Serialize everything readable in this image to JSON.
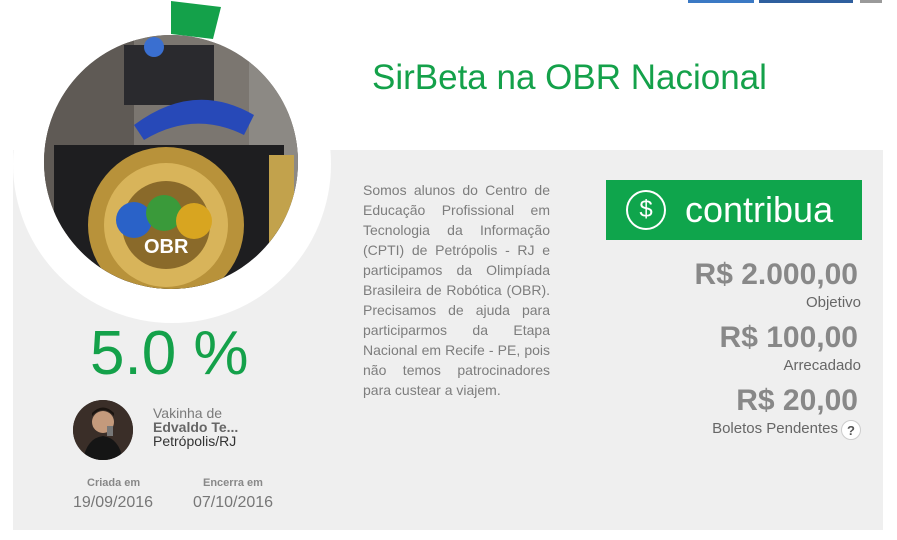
{
  "campaign": {
    "title": "SirBeta na OBR Nacional",
    "progress_percent_text": "5.0 %",
    "progress_fraction": 0.05,
    "description": "Somos alunos do Centro de Educação Profissional em Tecnologia da Informação (CPTI) de Petrópolis - RJ e participamos da Olimpíada Brasileira de Robótica (OBR). Precisamos de ajuda para participarmos da Etapa Nacional em Recife - PE, pois não temos patrocinadores para custear a viajem."
  },
  "owner": {
    "caption": "Vakinha de",
    "name": "Edvaldo Te...",
    "city": "Petrópolis/RJ"
  },
  "dates": {
    "created_label": "Criada em",
    "created_value": "19/09/2016",
    "ends_label": "Encerra em",
    "ends_value": "07/10/2016"
  },
  "cta": {
    "label": "contribua",
    "icon_glyph": "$",
    "icon": "dollar-circle-icon"
  },
  "stats": {
    "goal_value": "R$ 2.000,00",
    "goal_label": "Objetivo",
    "raised_value": "R$ 100,00",
    "raised_label": "Arrecadado",
    "pending_value": "R$ 20,00",
    "pending_label": "Boletos Pendentes",
    "help_glyph": "?"
  },
  "colors": {
    "accent_green": "#14a14a",
    "button_green": "#0fa54c",
    "panel_gray": "#efefef",
    "stat_gray": "#888888"
  }
}
